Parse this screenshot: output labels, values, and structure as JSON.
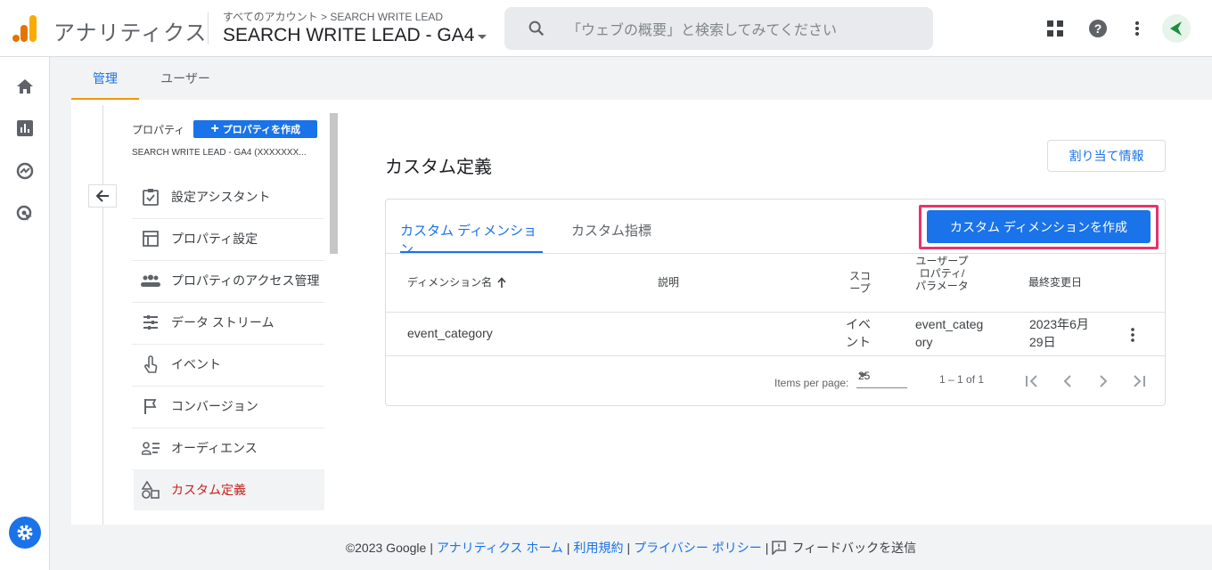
{
  "header": {
    "app_title": "アナリティクス",
    "breadcrumb": "すべてのアカウント > SEARCH WRITE LEAD",
    "property_name": "SEARCH WRITE LEAD - GA4",
    "search_placeholder": "「ウェブの概要」と検索してみてください"
  },
  "tabs": [
    {
      "label": "管理",
      "active": true
    },
    {
      "label": "ユーザー",
      "active": false
    }
  ],
  "property_panel": {
    "label": "プロパティ",
    "create_button": "プロパティを作成",
    "account_line": "SEARCH WRITE LEAD - GA4 (XXXXXXX..."
  },
  "menu_items": [
    {
      "label": "設定アシスタント",
      "icon": "checklist-icon"
    },
    {
      "label": "プロパティ設定",
      "icon": "layout-icon"
    },
    {
      "label": "プロパティのアクセス管理",
      "icon": "people-icon"
    },
    {
      "label": "データ ストリーム",
      "icon": "streams-icon"
    },
    {
      "label": "イベント",
      "icon": "touch-icon"
    },
    {
      "label": "コンバージョン",
      "icon": "flag-icon"
    },
    {
      "label": "オーディエンス",
      "icon": "audience-icon"
    },
    {
      "label": "カスタム定義",
      "icon": "shapes-icon",
      "active": true
    }
  ],
  "main": {
    "title": "カスタム定義",
    "assign_button": "割り当て情報",
    "card_tabs": [
      {
        "label": "カスタム ディメンション",
        "active": true
      },
      {
        "label": "カスタム指標",
        "active": false
      }
    ],
    "create_button": "カスタム ディメンションを作成",
    "table": {
      "headers": {
        "name": "ディメンション名",
        "description": "説明",
        "scope": "スコープ",
        "user_property": "ユーザープロパティ/ パラメータ",
        "last_modified": "最終変更日"
      },
      "rows": [
        {
          "name": "event_category",
          "description": "",
          "scope": "イベント",
          "user_property": "event_category",
          "last_modified": "2023年6月29日"
        }
      ]
    },
    "pagination": {
      "items_label": "Items per page:",
      "page_size": "25",
      "range": "1 – 1 of 1"
    }
  },
  "footer": {
    "copyright": "©2023 Google",
    "links": [
      "アナリティクス ホーム",
      "利用規約",
      "プライバシー ポリシー"
    ],
    "feedback": "フィードバックを送信"
  },
  "colors": {
    "accent": "#1a73e8",
    "highlight_border": "#e8336b",
    "active_menu_text": "#c5221f",
    "tab_indicator": "#f29900"
  }
}
